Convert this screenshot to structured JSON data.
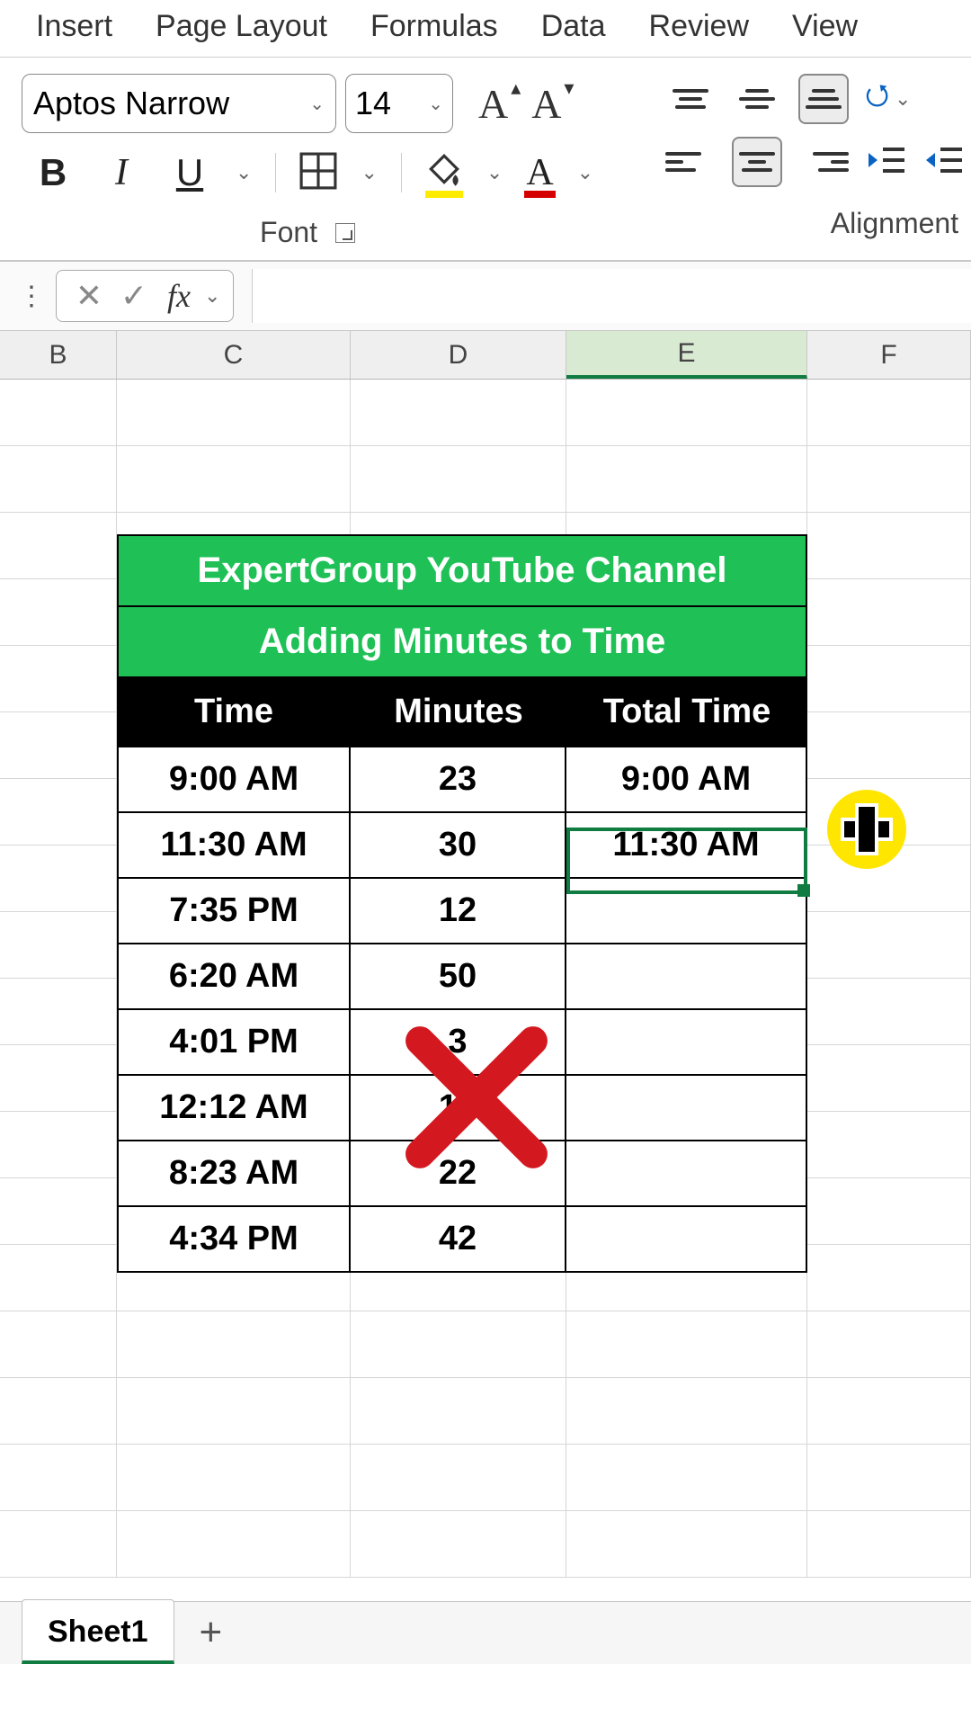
{
  "ribbon_tabs": {
    "insert": "Insert",
    "page_layout": "Page Layout",
    "formulas": "Formulas",
    "data": "Data",
    "review": "Review",
    "view": "View"
  },
  "font": {
    "name": "Aptos Narrow",
    "size": "14",
    "group_label": "Font"
  },
  "alignment": {
    "group_label": "Alignment"
  },
  "formula_bar": {
    "value": ""
  },
  "columns": {
    "B": "B",
    "C": "C",
    "D": "D",
    "E": "E",
    "F": "F"
  },
  "table": {
    "title": "ExpertGroup YouTube Channel",
    "subtitle": "Adding Minutes to Time",
    "headers": {
      "time": "Time",
      "minutes": "Minutes",
      "total": "Total Time"
    },
    "rows": [
      {
        "time": "9:00 AM",
        "minutes": "23",
        "total": "9:00 AM"
      },
      {
        "time": "11:30 AM",
        "minutes": "30",
        "total": "11:30 AM"
      },
      {
        "time": "7:35 PM",
        "minutes": "12",
        "total": ""
      },
      {
        "time": "6:20 AM",
        "minutes": "50",
        "total": ""
      },
      {
        "time": "4:01 PM",
        "minutes": "3",
        "total": ""
      },
      {
        "time": "12:12 AM",
        "minutes": "12",
        "total": ""
      },
      {
        "time": "8:23 AM",
        "minutes": "22",
        "total": ""
      },
      {
        "time": "4:34 PM",
        "minutes": "42",
        "total": ""
      }
    ]
  },
  "sheets": {
    "active": "Sheet1"
  }
}
